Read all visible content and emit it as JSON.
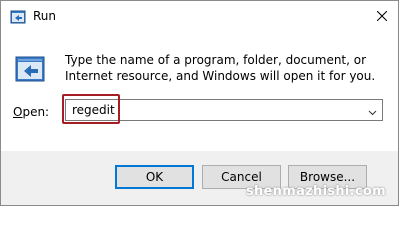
{
  "window": {
    "title": "Run",
    "icon": "run-app-icon",
    "close_icon": "close-icon"
  },
  "content": {
    "description": "Type the name of a program, folder, document, or Internet resource, and Windows will open it for you.",
    "big_icon": "run-dialog-icon",
    "open_label_mnemonic": "O",
    "open_label_rest": "pen:",
    "input_value": "regedit",
    "dropdown_icon": "chevron-down-icon",
    "highlight_color": "#a61e24"
  },
  "buttons": {
    "ok": "OK",
    "cancel": "Cancel",
    "browse": "Browse..."
  },
  "watermark": "shenmazhishi.com",
  "colors": {
    "accent": "#0078d7",
    "footer_bg": "#f0f0f0"
  }
}
